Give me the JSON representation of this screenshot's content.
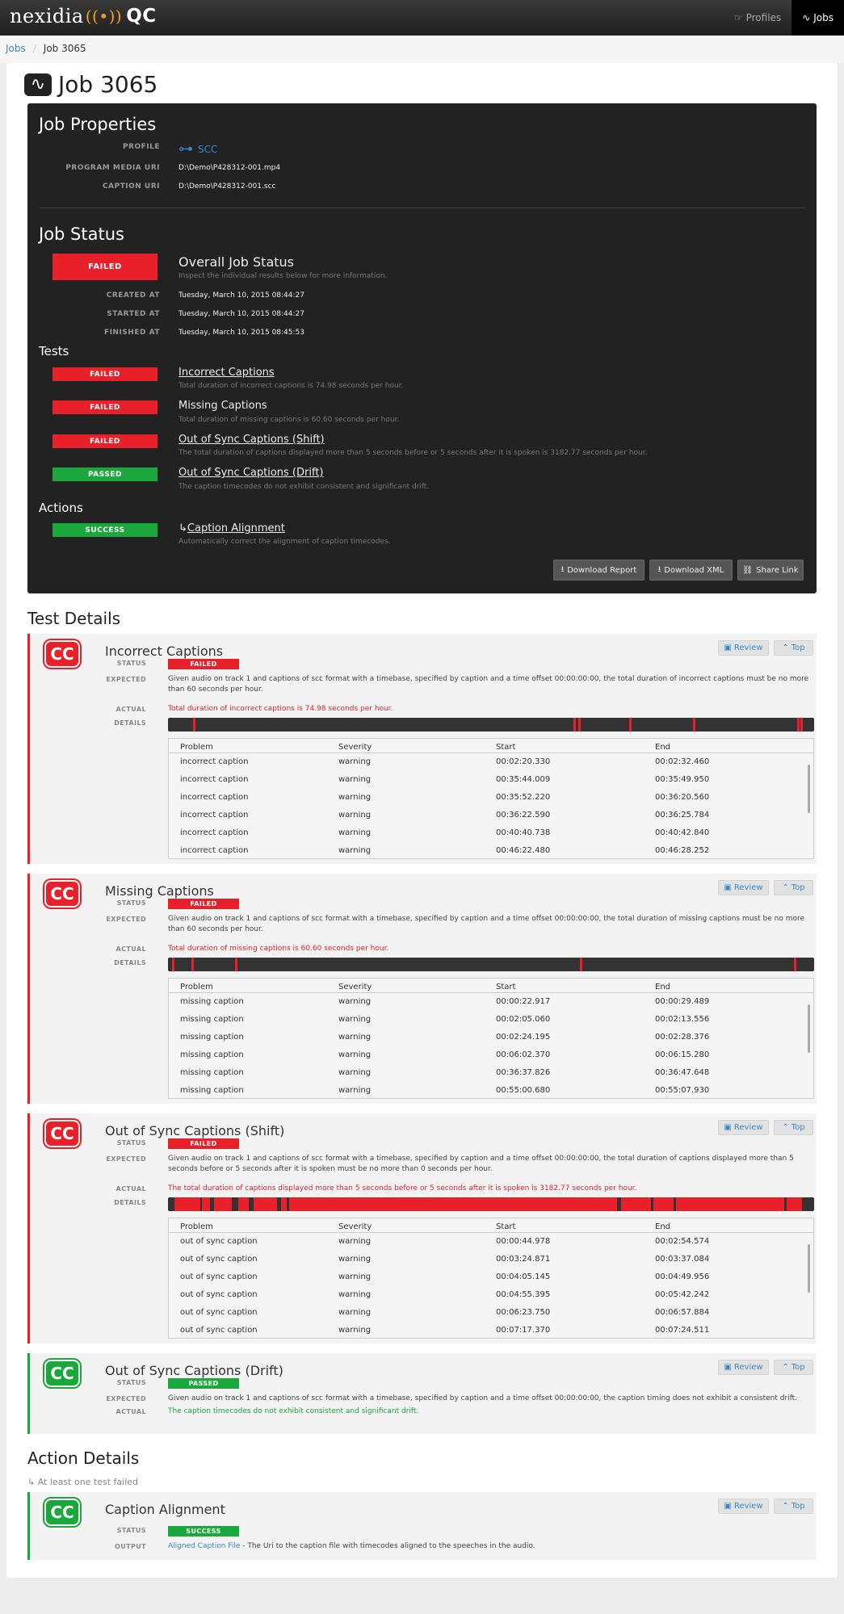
{
  "nav": {
    "logo_text": "nexidia",
    "logo_suffix": "QC",
    "profiles": "Profiles",
    "jobs": "Jobs"
  },
  "breadcrumb": {
    "root": "Jobs",
    "current": "Job 3065"
  },
  "job": {
    "title": "Job 3065"
  },
  "properties": {
    "heading": "Job Properties",
    "profile_label": "PROFILE",
    "profile_value": "SCC",
    "media_label": "PROGRAM MEDIA URI",
    "media_value": "D:\\Demo\\P428312-001.mp4",
    "caption_label": "CAPTION URI",
    "caption_value": "D:\\Demo\\P428312-001.scc"
  },
  "status": {
    "heading": "Job Status",
    "badge": "FAILED",
    "title": "Overall Job Status",
    "subtitle": "Inspect the individual results below for more information.",
    "created_label": "CREATED AT",
    "created": "Tuesday, March 10, 2015 08:44:27",
    "started_label": "STARTED AT",
    "started": "Tuesday, March 10, 2015 08:44:27",
    "finished_label": "FINISHED AT",
    "finished": "Tuesday, March 10, 2015 08:45:53"
  },
  "tests_heading": "Tests",
  "tests": [
    {
      "badge": "FAILED",
      "name": "Incorrect Captions",
      "desc": "Total duration of incorrect captions is 74.98 seconds per hour."
    },
    {
      "badge": "FAILED",
      "name": "Missing Captions",
      "desc": "Total duration of missing captions is 60.60 seconds per hour."
    },
    {
      "badge": "FAILED",
      "name": "Out of Sync Captions (Shift)",
      "desc": "The total duration of captions displayed more than 5 seconds before or 5 seconds after it is spoken is 3182.77 seconds per hour."
    },
    {
      "badge": "PASSED",
      "name": "Out of Sync Captions (Drift)",
      "desc": "The caption timecodes do not exhibit consistent and significant drift."
    }
  ],
  "actions_heading": "Actions",
  "action": {
    "badge": "SUCCESS",
    "arrow": "↳",
    "name": "Caption Alignment",
    "desc": "Automatically correct the alignment of caption timecodes."
  },
  "buttons": {
    "report": "Download Report",
    "xml": "Download XML",
    "share": "Share Link"
  },
  "test_details_heading": "Test Details",
  "labels": {
    "status": "STATUS",
    "expected": "EXPECTED",
    "actual": "ACTUAL",
    "details": "DETAILS",
    "output": "OUTPUT",
    "review": "Review",
    "top": "Top",
    "cc": "CC"
  },
  "columns": {
    "problem": "Problem",
    "severity": "Severity",
    "start": "Start",
    "end": "End"
  },
  "details": [
    {
      "name": "Incorrect Captions",
      "status": "FAILED",
      "expected": "Given audio on track 1 and captions of scc format with a timebase, specified by caption and a time offset 00:00:00:00, the total duration of incorrect captions must be no more than 60 seconds per hour.",
      "actual": "Total duration of incorrect captions is 74.98 seconds per hour.",
      "timeline": [
        3.9,
        62.8,
        63.5,
        71.4,
        81.3,
        97.4,
        97.9
      ],
      "rows": [
        [
          "incorrect caption",
          "warning",
          "00:02:20.330",
          "00:02:32.460"
        ],
        [
          "incorrect caption",
          "warning",
          "00:35:44.009",
          "00:35:49.950"
        ],
        [
          "incorrect caption",
          "warning",
          "00:35:52.220",
          "00:36:20.560"
        ],
        [
          "incorrect caption",
          "warning",
          "00:36:22.590",
          "00:36:25.784"
        ],
        [
          "incorrect caption",
          "warning",
          "00:40:40.738",
          "00:40:42.840"
        ],
        [
          "incorrect caption",
          "warning",
          "00:46:22.480",
          "00:46:28.252"
        ]
      ]
    },
    {
      "name": "Missing Captions",
      "status": "FAILED",
      "expected": "Given audio on track 1 and captions of scc format with a timebase, specified by caption and a time offset 00:00:00:00, the total duration of missing captions must be no more than 60 seconds per hour.",
      "actual": "Total duration of missing captions is 60.60 seconds per hour.",
      "timeline": [
        0.6,
        3.6,
        10.4,
        63.8,
        96.9
      ],
      "rows": [
        [
          "missing caption",
          "warning",
          "00:00:22.917",
          "00:00:29.489"
        ],
        [
          "missing caption",
          "warning",
          "00:02:05.060",
          "00:02:13.556"
        ],
        [
          "missing caption",
          "warning",
          "00:02:24.195",
          "00:02:28.376"
        ],
        [
          "missing caption",
          "warning",
          "00:06:02.370",
          "00:06:15.280"
        ],
        [
          "missing caption",
          "warning",
          "00:36:37.826",
          "00:36:47.648"
        ],
        [
          "missing caption",
          "warning",
          "00:55:00.680",
          "00:55:07.930"
        ]
      ]
    },
    {
      "name": "Out of Sync Captions (Shift)",
      "status": "FAILED",
      "expected": "Given audio on track 1 and captions of scc format with a timebase, specified by caption and a time offset 00:00:00:00, the total duration of captions displayed more than 5 seconds before or 5 seconds after it is spoken must be no more than 0 seconds per hour.",
      "actual": "The total duration of captions displayed more than 5 seconds before or 5 seconds after it is spoken is 3182.77 seconds per hour.",
      "rows": [
        [
          "out of sync caption",
          "warning",
          "00:00:44.978",
          "00:02:54.574"
        ],
        [
          "out of sync caption",
          "warning",
          "00:03:24.871",
          "00:03:37.084"
        ],
        [
          "out of sync caption",
          "warning",
          "00:04:05.145",
          "00:04:49.956"
        ],
        [
          "out of sync caption",
          "warning",
          "00:04:55.395",
          "00:05:42.242"
        ],
        [
          "out of sync caption",
          "warning",
          "00:06:23.750",
          "00:06:57.884"
        ],
        [
          "out of sync caption",
          "warning",
          "00:07:17.370",
          "00:07:24.511"
        ]
      ]
    },
    {
      "name": "Out of Sync Captions (Drift)",
      "status": "PASSED",
      "expected": "Given audio on track 1 and captions of scc format with a timebase, specified by caption and a time offset 00:00:00:00, the caption timing does not exhibit a consistent drift.",
      "actual": "The caption timecodes do not exhibit consistent and significant drift."
    }
  ],
  "action_details": {
    "heading": "Action Details",
    "note": "At least one test failed",
    "name": "Caption Alignment",
    "status": "SUCCESS",
    "output_link": "Aligned Caption File",
    "output_text": " - The Uri to the caption file with timecodes aligned to the speeches in the audio."
  },
  "colors": {
    "fail": "#e8202a",
    "pass": "#1aa83c",
    "link": "#3a87c8"
  }
}
